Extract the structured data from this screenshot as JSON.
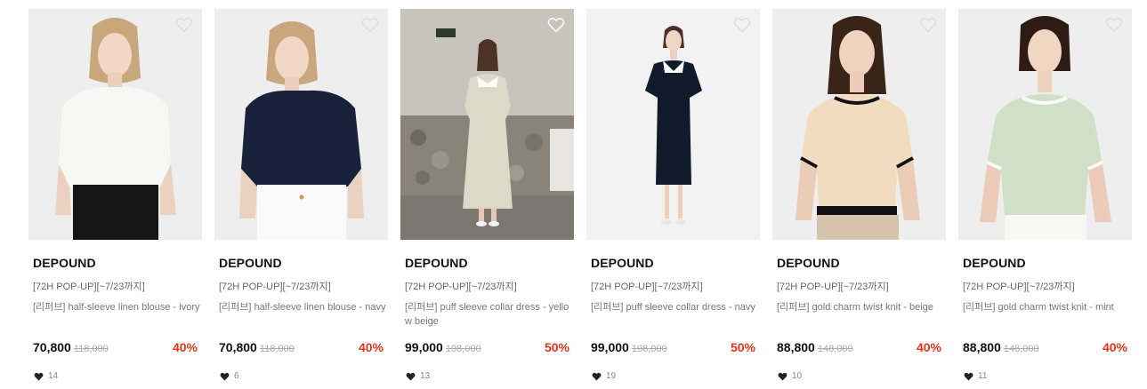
{
  "products": [
    {
      "brand": "DEPOUND",
      "promo": "[72H POP-UP][~7/23까지]",
      "name": "[리퍼브] half-sleeve linen blouse - ivory",
      "price": "70,800",
      "original_price": "118,000",
      "discount": "40%",
      "likes": "14",
      "wished": false
    },
    {
      "brand": "DEPOUND",
      "promo": "[72H POP-UP][~7/23까지]",
      "name": "[리퍼브] half-sleeve linen blouse - navy",
      "price": "70,800",
      "original_price": "118,000",
      "discount": "40%",
      "likes": "6",
      "wished": false
    },
    {
      "brand": "DEPOUND",
      "promo": "[72H POP-UP][~7/23까지]",
      "name": "[리퍼브] puff sleeve collar dress - yellow beige",
      "price": "99,000",
      "original_price": "198,000",
      "discount": "50%",
      "likes": "13",
      "wished": false
    },
    {
      "brand": "DEPOUND",
      "promo": "[72H POP-UP][~7/23까지]",
      "name": "[리퍼브] puff sleeve collar dress - navy",
      "price": "99,000",
      "original_price": "198,000",
      "discount": "50%",
      "likes": "19",
      "wished": false
    },
    {
      "brand": "DEPOUND",
      "promo": "[72H POP-UP][~7/23까지]",
      "name": "[리퍼브] gold charm twist knit - beige",
      "price": "88,800",
      "original_price": "148,000",
      "discount": "40%",
      "likes": "10",
      "wished": false
    },
    {
      "brand": "DEPOUND",
      "promo": "[72H POP-UP][~7/23까지]",
      "name": "[리퍼브] gold charm twist knit - mint",
      "price": "88,800",
      "original_price": "148,000",
      "discount": "40%",
      "likes": "11",
      "wished": false
    }
  ],
  "colors": {
    "discount": "#e2361b",
    "brand_text": "#111111",
    "meta_text": "#777777"
  },
  "icons": {
    "wishlist": "heart-outline-icon",
    "likes": "heart-filled-icon"
  }
}
